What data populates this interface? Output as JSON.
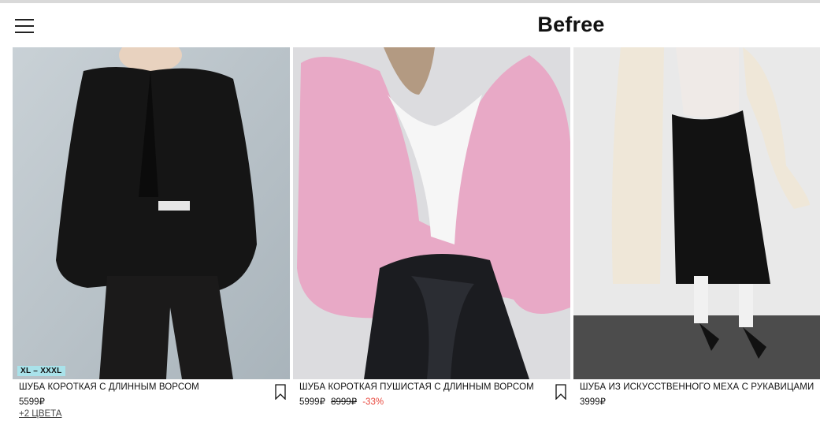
{
  "header": {
    "logo": "Befree",
    "menu_icon": "hamburger-menu-icon"
  },
  "products": [
    {
      "title": "ШУБА КОРОТКАЯ С ДЛИННЫМ ВОРСОМ",
      "price": "5599₽",
      "size_badge": "XL – XXXL",
      "colors_link": "+2 ЦВЕТА",
      "color": "#141414"
    },
    {
      "title": "ШУБА КОРОТКАЯ ПУШИСТАЯ С ДЛИННЫМ ВОРСОМ",
      "price": "5999₽",
      "old_price": "8999₽",
      "discount": "-33%",
      "color": "#e7a6c5"
    },
    {
      "title": "ШУБА ИЗ ИСКУССТВЕННОГО МЕХА С РУКАВИЦАМИ",
      "price": "3999₽",
      "color": "#efe6d6"
    }
  ],
  "icons": {
    "bookmark": "bookmark-icon"
  },
  "colors": {
    "discount": "#e8473c",
    "badge": "#a9e2ea"
  }
}
